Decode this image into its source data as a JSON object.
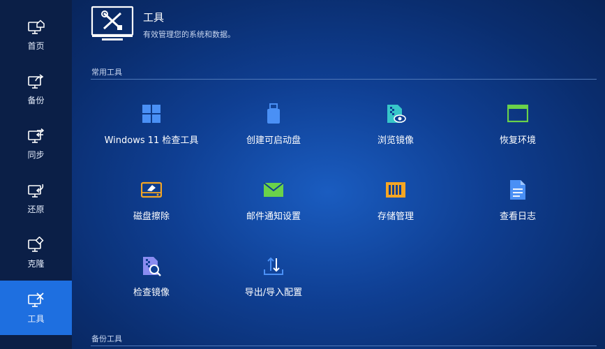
{
  "sidebar": {
    "items": [
      {
        "label": "首页",
        "icon": "home-monitor-icon"
      },
      {
        "label": "备份",
        "icon": "backup-monitor-icon"
      },
      {
        "label": "同步",
        "icon": "sync-monitor-icon"
      },
      {
        "label": "还原",
        "icon": "restore-monitor-icon"
      },
      {
        "label": "克隆",
        "icon": "clone-monitor-icon"
      },
      {
        "label": "工具",
        "icon": "tools-monitor-icon",
        "active": true
      }
    ]
  },
  "header": {
    "title": "工具",
    "subtitle": "有效管理您的系统和数据。",
    "icon": "tools-monitor-icon"
  },
  "sections": {
    "common": {
      "label": "常用工具",
      "tools": [
        {
          "label": "Windows 11 检查工具",
          "icon": "windows-logo-icon"
        },
        {
          "label": "创建可启动盘",
          "icon": "usb-drive-icon"
        },
        {
          "label": "浏览镜像",
          "icon": "browse-image-icon"
        },
        {
          "label": "恢复环境",
          "icon": "recovery-window-icon"
        },
        {
          "label": "磁盘擦除",
          "icon": "disk-wipe-icon"
        },
        {
          "label": "邮件通知设置",
          "icon": "email-icon"
        },
        {
          "label": "存储管理",
          "icon": "storage-icon"
        },
        {
          "label": "查看日志",
          "icon": "log-file-icon"
        },
        {
          "label": "检查镜像",
          "icon": "check-image-icon"
        },
        {
          "label": "导出/导入配置",
          "icon": "export-import-icon"
        }
      ]
    },
    "backup": {
      "label": "备份工具"
    }
  },
  "colors": {
    "sidebar_bg": "#0b1f47",
    "sidebar_active": "#1e6fe0",
    "accent_blue": "#4a90f5",
    "icon_green": "#6ad24a",
    "icon_orange": "#f5a623",
    "icon_cyan": "#37c6c9"
  }
}
